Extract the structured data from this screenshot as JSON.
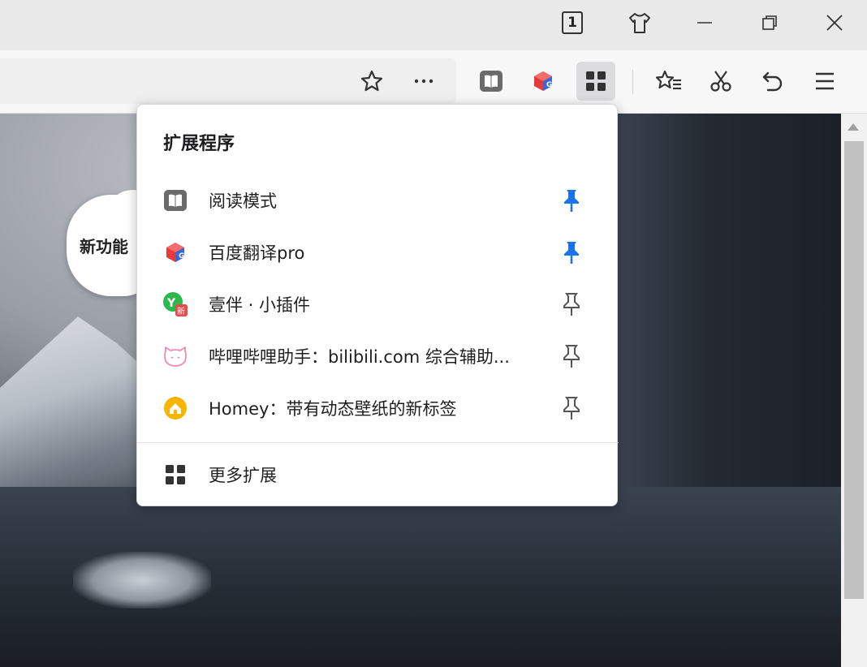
{
  "titlebar": {
    "tab_count": "1"
  },
  "toolbar": {
    "icons": [
      "star-icon",
      "more-icon",
      "reader-mode-icon",
      "baidu-translate-icon",
      "extensions-icon",
      "favorites-icon",
      "scissors-icon",
      "undo-icon",
      "menu-icon"
    ]
  },
  "page": {
    "cloud_text": "新功能"
  },
  "extensions_popup": {
    "title": "扩展程序",
    "items": [
      {
        "label": "阅读模式",
        "pinned": true,
        "icon": "reader-mode-icon"
      },
      {
        "label": "百度翻译pro",
        "pinned": true,
        "icon": "baidu-translate-icon"
      },
      {
        "label": "壹伴 · 小插件",
        "pinned": false,
        "icon": "yiban-icon"
      },
      {
        "label": "哔哩哔哩助手：bilibili.com 综合辅助...",
        "pinned": false,
        "icon": "bilibili-icon"
      },
      {
        "label": "Homey：带有动态壁纸的新标签",
        "pinned": false,
        "icon": "homey-icon"
      }
    ],
    "more_label": "更多扩展"
  },
  "colors": {
    "pin_active": "#1a73e8",
    "pin_inactive": "#555555"
  }
}
